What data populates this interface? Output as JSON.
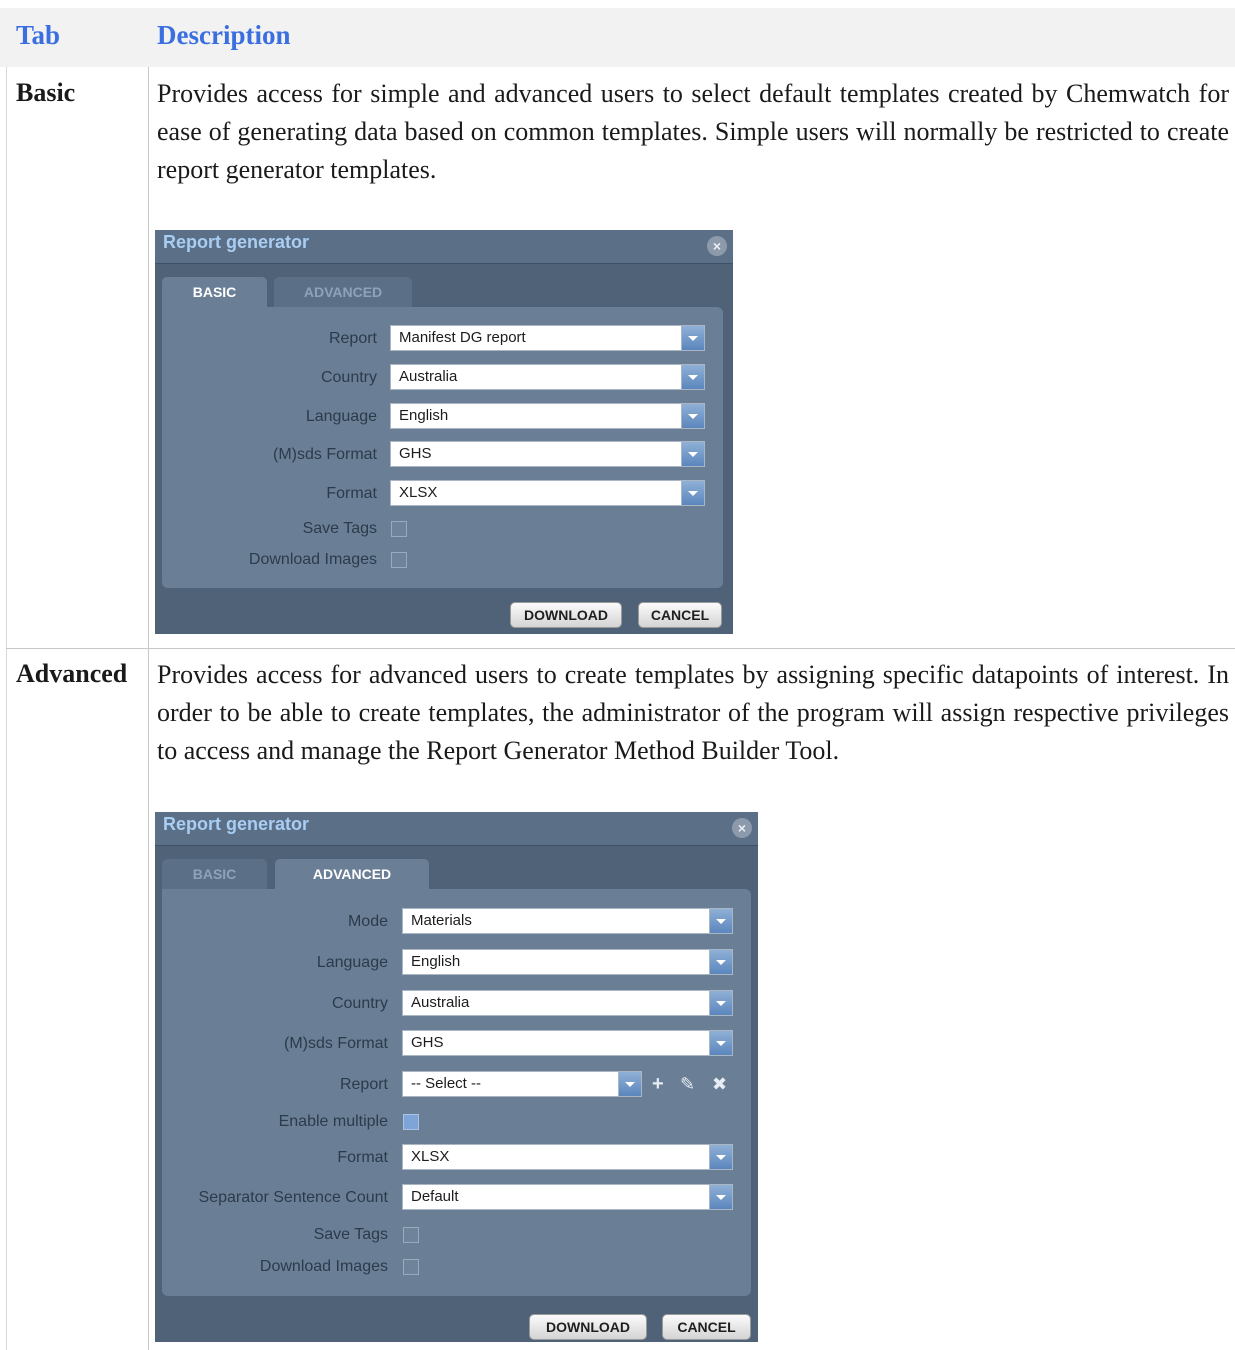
{
  "header": {
    "col1": "Tab",
    "col2": "Description"
  },
  "rows": [
    {
      "tab": "Basic",
      "description": "Provides access for simple and advanced users to select default templates created by Chemwatch for ease of generating data based on common templates. Simple users will normally be restricted to create report generator templates.",
      "dialog": {
        "title": "Report generator",
        "close": "×",
        "tabs": [
          "BASIC",
          "ADVANCED"
        ],
        "active_tab": "BASIC",
        "fields": {
          "report": {
            "label": "Report",
            "value": "Manifest DG report"
          },
          "country": {
            "label": "Country",
            "value": "Australia"
          },
          "language": {
            "label": "Language",
            "value": "English"
          },
          "msds_format": {
            "label": "(M)sds Format",
            "value": "GHS"
          },
          "format": {
            "label": "Format",
            "value": "XLSX"
          },
          "save_tags": {
            "label": "Save Tags",
            "checked": false
          },
          "download_images": {
            "label": "Download Images",
            "checked": false
          }
        },
        "buttons": {
          "download": "DOWNLOAD",
          "cancel": "CANCEL"
        }
      }
    },
    {
      "tab": "Advanced",
      "description": "Provides access for advanced users to create templates by assigning specific datapoints of interest. In order to be able to create templates, the administrator of the program will assign respective privileges to access and manage the Report Generator Method Builder Tool.",
      "dialog": {
        "title": "Report generator",
        "close": "×",
        "tabs": [
          "BASIC",
          "ADVANCED"
        ],
        "active_tab": "ADVANCED",
        "fields": {
          "mode": {
            "label": "Mode",
            "value": "Materials"
          },
          "language": {
            "label": "Language",
            "value": "English"
          },
          "country": {
            "label": "Country",
            "value": "Australia"
          },
          "msds_format": {
            "label": "(M)sds Format",
            "value": "GHS"
          },
          "report": {
            "label": "Report",
            "value": "-- Select --"
          },
          "enable_multiple": {
            "label": "Enable multiple",
            "checked": true
          },
          "format": {
            "label": "Format",
            "value": "XLSX"
          },
          "separator": {
            "label": "Separator Sentence Count",
            "value": "Default"
          },
          "save_tags": {
            "label": "Save Tags",
            "checked": false
          },
          "download_images": {
            "label": "Download Images",
            "checked": false
          }
        },
        "report_tools": {
          "add": "+",
          "edit": "✎",
          "delete": "✖"
        },
        "buttons": {
          "download": "DOWNLOAD",
          "cancel": "CANCEL"
        }
      }
    }
  ]
}
